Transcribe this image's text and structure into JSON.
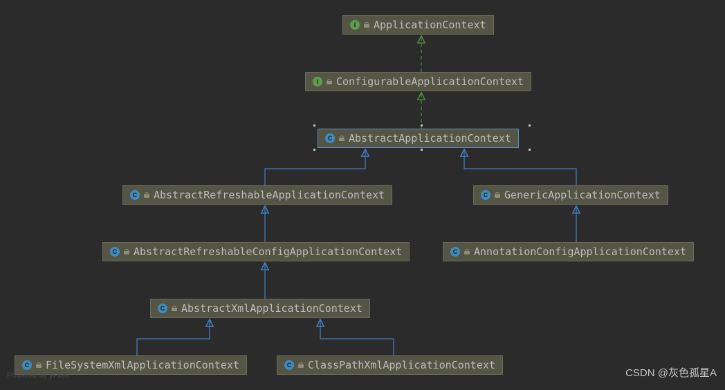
{
  "nodes": {
    "applicationContext": {
      "label": "ApplicationContext",
      "type": "interface"
    },
    "configurableAppContext": {
      "label": "ConfigurableApplicationContext",
      "type": "interface"
    },
    "abstractAppContext": {
      "label": "AbstractApplicationContext",
      "type": "class"
    },
    "abstractRefreshable": {
      "label": "AbstractRefreshableApplicationContext",
      "type": "class"
    },
    "genericAppContext": {
      "label": "GenericApplicationContext",
      "type": "class"
    },
    "abstractRefreshableConfig": {
      "label": "AbstractRefreshableConfigApplicationContext",
      "type": "class"
    },
    "annotationConfig": {
      "label": "AnnotationConfigApplicationContext",
      "type": "class"
    },
    "abstractXml": {
      "label": "AbstractXmlApplicationContext",
      "type": "class"
    },
    "fileSystemXml": {
      "label": "FileSystemXmlApplicationContext",
      "type": "class"
    },
    "classPathXml": {
      "label": "ClassPathXmlApplicationContext",
      "type": "class"
    }
  },
  "watermarks": {
    "yfiles": "Powered by yFiles",
    "csdn": "CSDN @灰色孤星A"
  },
  "colors": {
    "implementsArrow": "#4d8b3b",
    "extendsArrow": "#3f7cbf"
  }
}
